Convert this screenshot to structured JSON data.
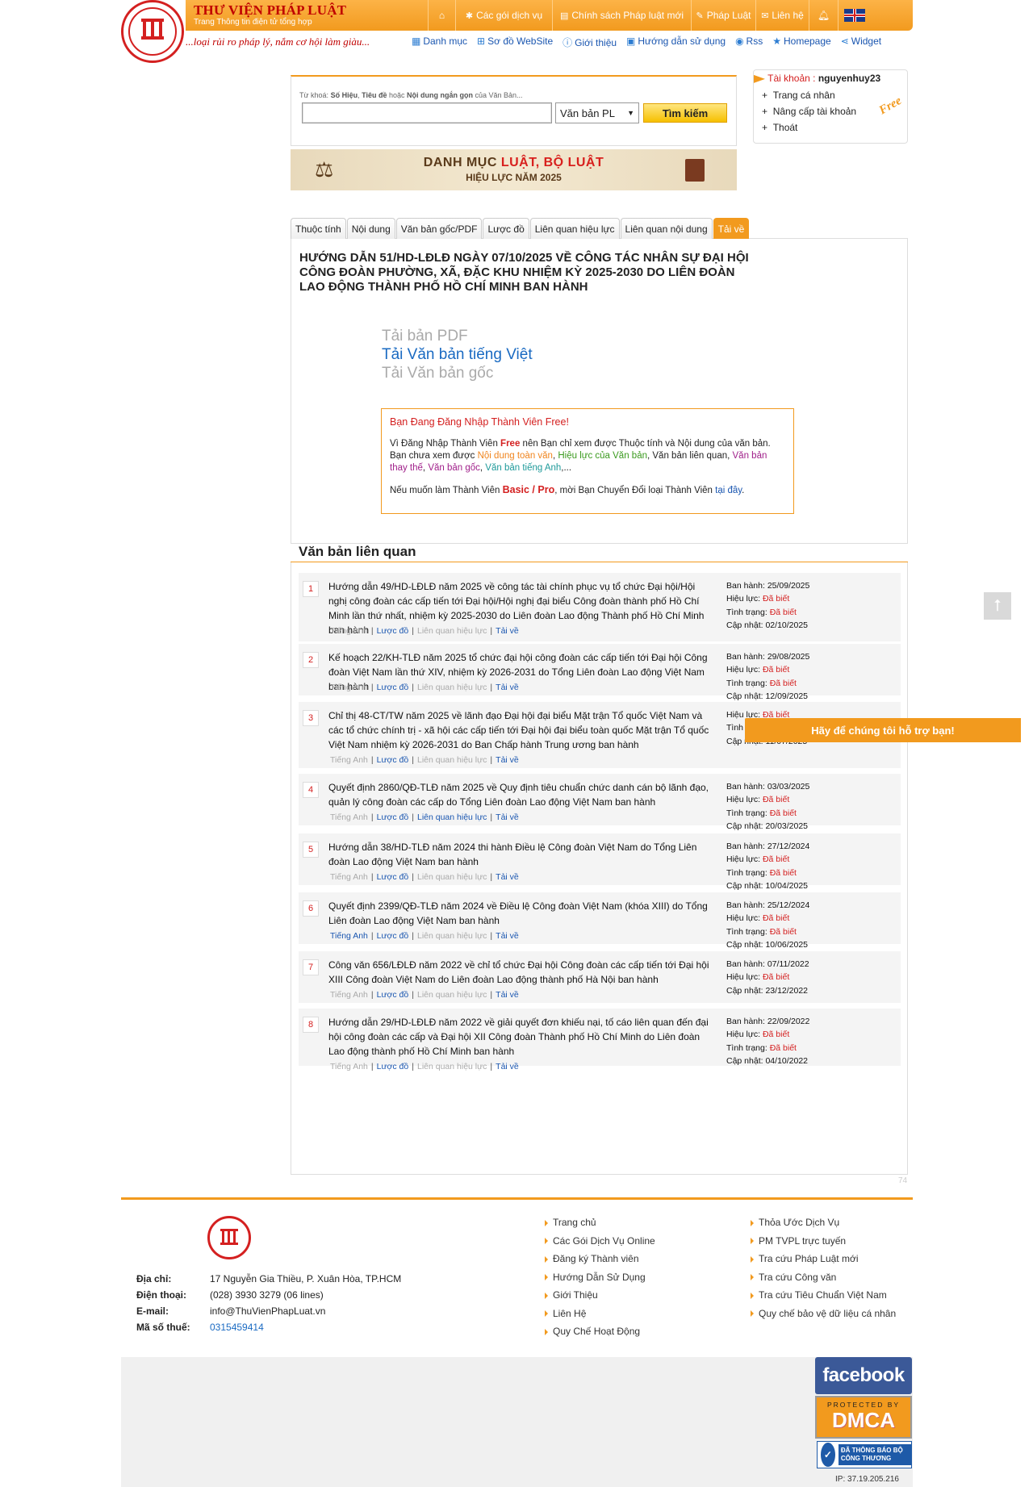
{
  "brand": {
    "title": "THƯ VIỆN PHÁP LUẬT",
    "subtitle": "Trang Thông tin điện tử tổng hợp",
    "slogan": "...loại rủi ro pháp lý, nắm cơ hội làm giàu..."
  },
  "topnav": [
    {
      "label": "",
      "icon": "home-icon"
    },
    {
      "label": "Các gói dịch vụ",
      "icon": "gear-icon"
    },
    {
      "label": "Chính sách Pháp luật mới",
      "icon": "newspaper-icon"
    },
    {
      "label": "Pháp Luật",
      "icon": "pin-icon"
    },
    {
      "label": "Liên hệ",
      "icon": "mail-icon"
    },
    {
      "label": "",
      "icon": "bell-icon"
    },
    {
      "label": "",
      "icon": "uk-flag-icon"
    }
  ],
  "subnav": [
    {
      "label": "Danh mục",
      "icon": "list-icon"
    },
    {
      "label": "Sơ đồ WebSite",
      "icon": "sitemap-icon"
    },
    {
      "label": "Giới thiệu",
      "icon": "info-icon"
    },
    {
      "label": "Hướng dẫn sử dụng",
      "icon": "book-icon"
    },
    {
      "label": "Rss",
      "icon": "rss-icon"
    },
    {
      "label": "Homepage",
      "icon": "star-icon"
    },
    {
      "label": "Widget",
      "icon": "share-icon"
    }
  ],
  "search": {
    "hint_prefix": "Từ khoá:",
    "hint_a": "Số Hiệu",
    "hint_sep1": ",",
    "hint_b": "Tiêu đề",
    "hint_sep2": "hoặc",
    "hint_c": "Nội dung ngắn gọn",
    "hint_suffix": "của Văn Bản...",
    "value": "",
    "select_value": "Văn bản PL",
    "button": "Tìm kiếm"
  },
  "banner": {
    "line1_a": "DANH MỤC",
    "line1_b": "LUẬT, BỘ LUẬT",
    "line2": "HIỆU LỰC NĂM 2025"
  },
  "account": {
    "label": "Tài khoản :",
    "username": "nguyenhuy23",
    "links": [
      "Trang cá nhân",
      "Nâng cấp tài khoản",
      "Thoát"
    ],
    "badge": "Free"
  },
  "tabs": [
    "Thuộc tính",
    "Nội dung",
    "Văn bản gốc/PDF",
    "Lược đồ",
    "Liên quan hiệu lực",
    "Liên quan nội dung",
    "Tải về"
  ],
  "document": {
    "title": "HƯỚNG DẪN 51/HD-LĐLĐ NGÀY 07/10/2025 VỀ CÔNG TÁC NHÂN SỰ ĐẠI HỘI CÔNG ĐOÀN PHƯỜNG, XÃ, ĐẶC KHU NHIỆM KỲ 2025-2030 DO LIÊN ĐOÀN LAO ĐỘNG THÀNH PHỐ HỒ CHÍ MINH BAN HÀNH"
  },
  "downloads": {
    "pdf": "Tải bản PDF",
    "vietnamese": "Tải Văn bản tiếng Việt",
    "original": "Tải Văn bản gốc"
  },
  "notice": {
    "heading": "Bạn Đang Đăng Nhập Thành Viên Free!",
    "p1_a": "Vì Đăng Nhập Thành Viên",
    "p1_free": "Free",
    "p1_b": "nên Bạn chỉ xem được Thuộc tính và Nội dung của văn bản.",
    "p2_a": "Bạn chưa xem được",
    "p2_full": "Nội dung toàn văn",
    "p2_eff": "Hiệu lực của Văn bản",
    "p2_mid": ", Văn bản liên quan,",
    "p2_rep": "Văn bản thay thế",
    "p2_orig": "Văn bản gốc",
    "p2_en": "Văn bản tiếng Anh",
    "p2_end": ",...",
    "p3_a": "Nếu muốn làm Thành Viên",
    "p3_basic": "Basic / Pro",
    "p3_b": ", mời Bạn Chuyển Đổi loại Thành Viên",
    "p3_link": "tại đây",
    "p3_end": "."
  },
  "related": {
    "heading": "Văn bản liên quan",
    "labels": {
      "issued": "Ban hành:",
      "effect": "Hiệu lực:",
      "status": "Tình trạng:",
      "updated": "Cập nhật:",
      "known": "Đã biết",
      "english": "Tiếng Anh",
      "diagram": "Lược đồ",
      "rel_effect": "Liên quan hiệu lực",
      "download": "Tải về"
    },
    "items": [
      {
        "num": "1",
        "title": "Hướng dẫn 49/HD-LĐLĐ năm 2025 về công tác tài chính phục vụ tổ chức Đại hội/Hội nghị công đoàn các cấp tiến tới Đại hội/Hội nghị đại biểu Công đoàn thành phố Hồ Chí Minh lần thứ nhất, nhiệm kỳ 2025-2030 do Liên đoàn Lao động Thành phố Hồ Chí Minh ban hành",
        "issued": "25/09/2025",
        "effect": true,
        "status": true,
        "updated": "02/10/2025",
        "english_on": false,
        "rel_on": false
      },
      {
        "num": "2",
        "title": "Kế hoạch 22/KH-TLĐ năm 2025 tổ chức đại hội công đoàn các cấp tiến tới Đại hội Công đoàn Việt Nam lần thứ XIV, nhiệm kỳ 2026-2031 do Tổng Liên đoàn Lao động Việt Nam ban hành",
        "issued": "29/08/2025",
        "effect": true,
        "status": true,
        "updated": "12/09/2025",
        "english_on": false,
        "rel_on": false
      },
      {
        "num": "3",
        "title": "Chỉ thị 48-CT/TW năm 2025 về lãnh đạo Đại hội đại biểu Mặt trận Tổ quốc Việt Nam và các tổ chức chính trị - xã hội các cấp tiến tới Đại hội đại biểu toàn quốc Mặt trận Tổ quốc Việt Nam nhiệm kỳ 2026-2031 do Ban Chấp hành Trung ương ban hành",
        "issued": "",
        "effect": true,
        "status": true,
        "updated": "11/07/2025",
        "english_on": false,
        "rel_on": false
      },
      {
        "num": "4",
        "title": "Quyết định 2860/QĐ-TLĐ năm 2025 về Quy định tiêu chuẩn chức danh cán bộ lãnh đạo, quản lý công đoàn các cấp do Tổng Liên đoàn Lao động Việt Nam ban hành",
        "issued": "03/03/2025",
        "effect": true,
        "status": true,
        "updated": "20/03/2025",
        "english_on": false,
        "rel_on": true
      },
      {
        "num": "5",
        "title": "Hướng dẫn 38/HD-TLĐ năm 2024 thi hành Điều lệ Công đoàn Việt Nam do Tổng Liên đoàn Lao động Việt Nam ban hành",
        "issued": "27/12/2024",
        "effect": true,
        "status": true,
        "updated": "10/04/2025",
        "english_on": false,
        "rel_on": false
      },
      {
        "num": "6",
        "title": "Quyết định 2399/QĐ-TLĐ năm 2024 về Điều lệ Công đoàn Việt Nam (khóa XIII) do Tổng Liên đoàn Lao động Việt Nam ban hành",
        "issued": "25/12/2024",
        "effect": true,
        "status": true,
        "updated": "10/06/2025",
        "english_on": true,
        "rel_on": false
      },
      {
        "num": "7",
        "title": "Công văn 656/LĐLĐ năm 2022 về chỉ tổ chức Đại hội Công đoàn các cấp tiến tới Đại hội XIII Công đoàn Việt Nam do Liên đoàn Lao động thành phố Hà Nội ban hành",
        "issued": "07/11/2022",
        "effect": true,
        "status": false,
        "updated": "23/12/2022",
        "english_on": false,
        "rel_on": false
      },
      {
        "num": "8",
        "title": "Hướng dẫn 29/HD-LĐLĐ năm 2022 về giải quyết đơn khiếu nại, tố cáo liên quan đến đại hội công đoàn các cấp và Đại hội XII Công đoàn Thành phố Hồ Chí Minh do Liên đoàn Lao động thành phố Hồ Chí Minh ban hành",
        "issued": "22/09/2022",
        "effect": true,
        "status": true,
        "updated": "04/10/2022",
        "english_on": false,
        "rel_on": false
      }
    ]
  },
  "counter": "74",
  "support": "Hãy để chúng tôi hỗ trợ bạn!",
  "footer": {
    "address_label": "Địa chỉ:",
    "address": "17 Nguyễn Gia Thiều, P. Xuân Hòa, TP.HCM",
    "phone_label": "Điện thoại:",
    "phone": "(028) 3930 3279 (06 lines)",
    "email_label": "E-mail:",
    "email": "info@ThuVienPhapLuat.vn",
    "tax_label": "Mã số thuế:",
    "tax": "0315459414",
    "col1": [
      "Trang chủ",
      "Các Gói Dịch Vụ Online",
      "Đăng ký Thành viên",
      "Hướng Dẫn Sử Dụng",
      "Giới Thiệu",
      "Liên Hệ",
      "Quy Chế Hoạt Động"
    ],
    "col2": [
      "Thỏa Ước Dịch Vụ",
      "PM TVPL trực tuyến",
      "Tra cứu Pháp Luật mới",
      "Tra cứu Công văn",
      "Tra cứu Tiêu Chuẩn Việt Nam",
      "Quy chế bảo vệ dữ liệu cá nhân"
    ]
  },
  "badges": {
    "facebook": "facebook",
    "dmca_top": "PROTECTED BY",
    "dmca": "DMCA",
    "bct": "ĐÃ THÔNG BÁO BỘ CÔNG THƯƠNG"
  },
  "ip": "IP: 37.19.205.216",
  "colors": {
    "accent": "#f29a1e",
    "brand_red": "#d42020",
    "link": "#1a56b0"
  }
}
